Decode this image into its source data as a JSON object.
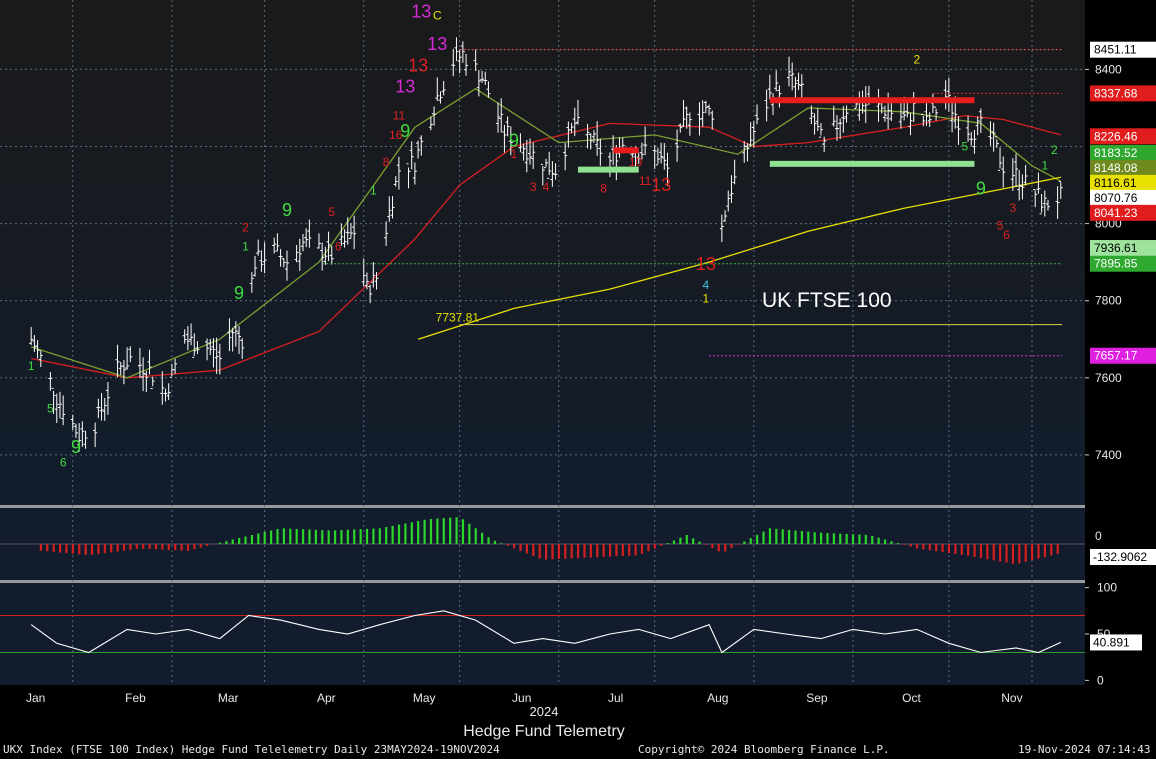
{
  "chart_data": [
    {
      "type": "ohlc",
      "title": "UK FTSE 100",
      "subtitle": "Hedge Fund Telemetry",
      "xlabel": "2024",
      "months": [
        "Jan",
        "Feb",
        "Mar",
        "Apr",
        "May",
        "Jun",
        "Jul",
        "Aug",
        "Sep",
        "Oct",
        "Nov"
      ],
      "ylim": [
        7270,
        8580
      ],
      "yticks": [
        7400,
        7600,
        7800,
        8000,
        8400
      ],
      "ytick_labels": [
        "7400",
        "7600",
        "7800",
        "8000",
        "8400"
      ],
      "grid": true,
      "close_path": [
        [
          "2024-01-02",
          7700
        ],
        [
          "2024-01-05",
          7650
        ],
        [
          "2024-01-10",
          7550
        ],
        [
          "2024-01-17",
          7450
        ],
        [
          "2024-01-22",
          7480
        ],
        [
          "2024-01-29",
          7620
        ],
        [
          "2024-02-02",
          7650
        ],
        [
          "2024-02-08",
          7620
        ],
        [
          "2024-02-13",
          7560
        ],
        [
          "2024-02-19",
          7700
        ],
        [
          "2024-02-26",
          7680
        ],
        [
          "2024-03-01",
          7650
        ],
        [
          "2024-03-05",
          7720
        ],
        [
          "2024-03-08",
          7700
        ],
        [
          "2024-03-12",
          7900
        ],
        [
          "2024-03-18",
          7930
        ],
        [
          "2024-03-22",
          7900
        ],
        [
          "2024-03-27",
          7950
        ],
        [
          "2024-04-02",
          7930
        ],
        [
          "2024-04-05",
          7920
        ],
        [
          "2024-04-09",
          7950
        ],
        [
          "2024-04-12",
          7980
        ],
        [
          "2024-04-16",
          7830
        ],
        [
          "2024-04-19",
          7860
        ],
        [
          "2024-04-23",
          8030
        ],
        [
          "2024-04-26",
          8140
        ],
        [
          "2024-05-01",
          8160
        ],
        [
          "2024-05-08",
          8330
        ],
        [
          "2024-05-13",
          8420
        ],
        [
          "2024-05-16",
          8440
        ],
        [
          "2024-05-22",
          8380
        ],
        [
          "2024-05-29",
          8240
        ],
        [
          "2024-06-04",
          8200
        ],
        [
          "2024-06-11",
          8150
        ],
        [
          "2024-06-14",
          8140
        ],
        [
          "2024-06-20",
          8260
        ],
        [
          "2024-06-25",
          8220
        ],
        [
          "2024-07-01",
          8160
        ],
        [
          "2024-07-05",
          8210
        ],
        [
          "2024-07-10",
          8190
        ],
        [
          "2024-07-16",
          8180
        ],
        [
          "2024-07-19",
          8140
        ],
        [
          "2024-07-26",
          8290
        ],
        [
          "2024-08-02",
          8290
        ],
        [
          "2024-08-05",
          7990
        ],
        [
          "2024-08-07",
          8070
        ],
        [
          "2024-08-14",
          8220
        ],
        [
          "2024-08-20",
          8330
        ],
        [
          "2024-08-26",
          8380
        ],
        [
          "2024-08-30",
          8340
        ],
        [
          "2024-09-06",
          8200
        ],
        [
          "2024-09-13",
          8300
        ],
        [
          "2024-09-20",
          8310
        ],
        [
          "2024-09-27",
          8290
        ],
        [
          "2024-10-02",
          8270
        ],
        [
          "2024-10-04",
          8300
        ],
        [
          "2024-10-08",
          8260
        ],
        [
          "2024-10-14",
          8330
        ],
        [
          "2024-10-18",
          8270
        ],
        [
          "2024-10-22",
          8240
        ],
        [
          "2024-10-25",
          8250
        ],
        [
          "2024-10-29",
          8210
        ],
        [
          "2024-11-01",
          8150
        ],
        [
          "2024-11-06",
          8120
        ],
        [
          "2024-11-11",
          8080
        ],
        [
          "2024-11-14",
          8050
        ],
        [
          "2024-11-19",
          8070
        ]
      ],
      "ma_red": [
        [
          "2024-01-02",
          7650
        ],
        [
          "2024-02-01",
          7600
        ],
        [
          "2024-03-01",
          7620
        ],
        [
          "2024-04-01",
          7720
        ],
        [
          "2024-05-01",
          7960
        ],
        [
          "2024-05-15",
          8100
        ],
        [
          "2024-06-01",
          8200
        ],
        [
          "2024-07-01",
          8260
        ],
        [
          "2024-08-01",
          8250
        ],
        [
          "2024-08-15",
          8200
        ],
        [
          "2024-09-01",
          8210
        ],
        [
          "2024-10-01",
          8250
        ],
        [
          "2024-10-20",
          8280
        ],
        [
          "2024-11-01",
          8270
        ],
        [
          "2024-11-19",
          8230
        ]
      ],
      "ma_green": [
        [
          "2024-01-02",
          7680
        ],
        [
          "2024-02-01",
          7600
        ],
        [
          "2024-03-01",
          7700
        ],
        [
          "2024-04-01",
          7900
        ],
        [
          "2024-05-01",
          8250
        ],
        [
          "2024-05-20",
          8350
        ],
        [
          "2024-06-15",
          8210
        ],
        [
          "2024-07-15",
          8230
        ],
        [
          "2024-08-10",
          8180
        ],
        [
          "2024-09-01",
          8300
        ],
        [
          "2024-10-01",
          8290
        ],
        [
          "2024-10-25",
          8260
        ],
        [
          "2024-11-10",
          8150
        ],
        [
          "2024-11-19",
          8110
        ]
      ],
      "ma_yellow": [
        [
          "2024-05-02",
          7700
        ],
        [
          "2024-06-01",
          7780
        ],
        [
          "2024-07-01",
          7830
        ],
        [
          "2024-08-01",
          7900
        ],
        [
          "2024-09-01",
          7980
        ],
        [
          "2024-10-01",
          8040
        ],
        [
          "2024-11-01",
          8090
        ],
        [
          "2024-11-19",
          8120
        ]
      ],
      "hlines": [
        {
          "value": 8451.11,
          "color": "#ff5a5a",
          "dashed": true,
          "from": "2024-05-15"
        },
        {
          "value": 8337.68,
          "color": "#e03030",
          "dashed": true,
          "from": "2024-10-10"
        },
        {
          "value": 7895.85,
          "color": "#3fbf3f",
          "dashed": true,
          "from": "2024-04-02"
        },
        {
          "value": 7737.81,
          "color": "#d8d040",
          "dashed": false,
          "from": "2024-05-15"
        },
        {
          "value": 7657.17,
          "color": "#cc33cc",
          "dashed": true,
          "from": "2024-08-01"
        }
      ],
      "range_text": "7737.81",
      "bars_red": [
        {
          "value": 8320,
          "from": "2024-08-20",
          "to": "2024-10-23"
        },
        {
          "value": 8190,
          "from": "2024-07-02",
          "to": "2024-07-10"
        }
      ],
      "bars_green": [
        {
          "value": 8155,
          "from": "2024-08-20",
          "to": "2024-10-23"
        },
        {
          "value": 8140,
          "from": "2024-06-21",
          "to": "2024-07-10"
        }
      ],
      "right_labels": [
        {
          "value": 8451.11,
          "text": "8451.11",
          "bg": "#ffffff",
          "fg": "#000000"
        },
        {
          "value": 8337.68,
          "text": "8337.68",
          "bg": "#e01c1c",
          "fg": "#ffffff"
        },
        {
          "value": 8226.46,
          "text": "8226.46",
          "bg": "#e01c1c",
          "fg": "#ffffff"
        },
        {
          "value": 8183.52,
          "text": "8183.52",
          "bg": "#2ea82e",
          "fg": "#ffffff"
        },
        {
          "value": 8148.08,
          "text": "8148.08",
          "bg": "#6e8a1e",
          "fg": "#ffffff"
        },
        {
          "value": 8116.61,
          "text": "8116.61",
          "bg": "#e8e000",
          "fg": "#000000"
        },
        {
          "value": 8070.76,
          "text": "8070.76",
          "bg": "#ffffff",
          "fg": "#000000"
        },
        {
          "value": 8041.23,
          "text": "8041.23",
          "bg": "#e01c1c",
          "fg": "#ffffff"
        },
        {
          "value": 7936.61,
          "text": "7936.61",
          "bg": "#9ee39e",
          "fg": "#000000"
        },
        {
          "value": 7895.85,
          "text": "7895.85",
          "bg": "#2ea82e",
          "fg": "#ffffff"
        },
        {
          "value": 7657.17,
          "text": "7657.17",
          "bg": "#e020e0",
          "fg": "#ffffff"
        }
      ],
      "annotations": [
        {
          "text": "13",
          "date": "2024-05-03",
          "value": 8535,
          "color": "#d62bd6"
        },
        {
          "text": "C",
          "date": "2024-05-08",
          "value": 8530,
          "color": "#e8e000"
        },
        {
          "text": "13",
          "date": "2024-05-08",
          "value": 8450,
          "color": "#d62bd6"
        },
        {
          "text": "13",
          "date": "2024-05-02",
          "value": 8395,
          "color": "#e02020"
        },
        {
          "text": "13",
          "date": "2024-04-28",
          "value": 8340,
          "color": "#d62bd6"
        },
        {
          "text": "9",
          "date": "2024-04-28",
          "value": 8225,
          "color": "#3fdc3f"
        },
        {
          "text": "9",
          "date": "2024-03-22",
          "value": 8020,
          "color": "#3fdc3f"
        },
        {
          "text": "9",
          "date": "2024-03-07",
          "value": 7805,
          "color": "#3fdc3f"
        },
        {
          "text": "9",
          "date": "2024-01-16",
          "value": 7405,
          "color": "#3fdc3f"
        },
        {
          "text": "9",
          "date": "2024-06-01",
          "value": 8200,
          "color": "#3fdc3f"
        },
        {
          "text": "9",
          "date": "2024-10-25",
          "value": 8075,
          "color": "#3fdc3f"
        },
        {
          "text": "13",
          "date": "2024-07-31",
          "value": 7880,
          "color": "#e02020"
        },
        {
          "text": "4",
          "date": "2024-07-31",
          "value": 7830,
          "color": "#40c0e0"
        },
        {
          "text": "1",
          "date": "2024-07-31",
          "value": 7795,
          "color": "#e8e000"
        },
        {
          "text": "2",
          "date": "2024-10-05",
          "value": 8415,
          "color": "#e8e000"
        },
        {
          "text": "1",
          "date": "2024-04-18",
          "value": 8075,
          "color": "#3fdc3f"
        },
        {
          "text": "8",
          "date": "2024-04-22",
          "value": 8150,
          "color": "#e02020"
        },
        {
          "text": "11",
          "date": "2024-04-26",
          "value": 8270,
          "color": "#e02020"
        },
        {
          "text": "16",
          "date": "2024-04-25",
          "value": 8220,
          "color": "#e02020"
        },
        {
          "text": "1",
          "date": "2024-01-02",
          "value": 7620,
          "color": "#3fdc3f"
        },
        {
          "text": "5",
          "date": "2024-01-08",
          "value": 7510,
          "color": "#3fdc3f"
        },
        {
          "text": "6",
          "date": "2024-01-12",
          "value": 7370,
          "color": "#3fdc3f"
        },
        {
          "text": "2",
          "date": "2024-03-09",
          "value": 7980,
          "color": "#e02020"
        },
        {
          "text": "1",
          "date": "2024-03-09",
          "value": 7930,
          "color": "#3fdc3f"
        },
        {
          "text": "5",
          "date": "2024-04-05",
          "value": 8020,
          "color": "#e02020"
        },
        {
          "text": "6",
          "date": "2024-04-07",
          "value": 7930,
          "color": "#e02020"
        },
        {
          "text": "1",
          "date": "2024-06-01",
          "value": 8170,
          "color": "#e02020"
        },
        {
          "text": "3",
          "date": "2024-06-07",
          "value": 8085,
          "color": "#e02020"
        },
        {
          "text": "4",
          "date": "2024-06-11",
          "value": 8085,
          "color": "#e02020"
        },
        {
          "text": "8",
          "date": "2024-06-29",
          "value": 8080,
          "color": "#e02020"
        },
        {
          "text": "10",
          "date": "2024-07-09",
          "value": 8150,
          "color": "#e02020"
        },
        {
          "text": "11",
          "date": "2024-07-12",
          "value": 8100,
          "color": "#e02020"
        },
        {
          "text": "13",
          "date": "2024-07-17",
          "value": 8085,
          "color": "#e02020"
        },
        {
          "text": "5",
          "date": "2024-10-20",
          "value": 8190,
          "color": "#3fdc3f"
        },
        {
          "text": "1",
          "date": "2024-11-14",
          "value": 8140,
          "color": "#3fdc3f"
        },
        {
          "text": "2",
          "date": "2024-11-17",
          "value": 8180,
          "color": "#3fdc3f"
        },
        {
          "text": "3",
          "date": "2024-11-04",
          "value": 8030,
          "color": "#e02020"
        },
        {
          "text": "5",
          "date": "2024-10-31",
          "value": 7985,
          "color": "#e02020"
        },
        {
          "text": "6",
          "date": "2024-11-02",
          "value": 7960,
          "color": "#e02020"
        }
      ],
      "color_red": "#d82020",
      "color_green": "#7aa030",
      "color_yellow": "#e8e000",
      "background": "#121c2c"
    },
    {
      "type": "bar",
      "title": "",
      "ylim": [
        -80,
        80
      ],
      "ytick_labels": [
        "0"
      ],
      "value_label": "-132.9062",
      "series": [
        {
          "name": "",
          "color_pos": "#2cd42c",
          "color_neg": "#d42020",
          "x": [
            "2024-01-05",
            "2024-01-20",
            "2024-02-05",
            "2024-02-20",
            "2024-03-05",
            "2024-03-20",
            "2024-04-05",
            "2024-04-20",
            "2024-05-05",
            "2024-05-15",
            "2024-05-25",
            "2024-06-10",
            "2024-06-25",
            "2024-07-10",
            "2024-07-25",
            "2024-08-05",
            "2024-08-20",
            "2024-09-05",
            "2024-09-20",
            "2024-10-05",
            "2024-10-20",
            "2024-11-05",
            "2024-11-19"
          ],
          "values": [
            -15,
            -25,
            -10,
            -15,
            10,
            35,
            30,
            35,
            55,
            60,
            10,
            -35,
            -30,
            -25,
            20,
            -20,
            35,
            25,
            20,
            -10,
            -25,
            -45,
            -20
          ]
        }
      ]
    },
    {
      "type": "line",
      "title": "",
      "ylim": [
        -5,
        105
      ],
      "yticks": [
        0,
        50,
        100
      ],
      "ytick_labels": [
        "0",
        "50",
        "100"
      ],
      "hlines": [
        70,
        30
      ],
      "value_label": "40.891",
      "series": [
        {
          "name": "",
          "color": "#ffffff",
          "x": [
            "2024-01-02",
            "2024-01-10",
            "2024-01-20",
            "2024-02-01",
            "2024-02-10",
            "2024-02-20",
            "2024-03-01",
            "2024-03-10",
            "2024-03-20",
            "2024-04-01",
            "2024-04-10",
            "2024-04-20",
            "2024-05-01",
            "2024-05-10",
            "2024-05-20",
            "2024-06-01",
            "2024-06-10",
            "2024-06-20",
            "2024-07-01",
            "2024-07-10",
            "2024-07-20",
            "2024-08-01",
            "2024-08-05",
            "2024-08-15",
            "2024-08-25",
            "2024-09-05",
            "2024-09-15",
            "2024-09-25",
            "2024-10-05",
            "2024-10-15",
            "2024-10-25",
            "2024-11-05",
            "2024-11-12",
            "2024-11-19"
          ],
          "values": [
            60,
            40,
            30,
            55,
            50,
            55,
            45,
            70,
            65,
            55,
            50,
            60,
            70,
            75,
            65,
            40,
            45,
            40,
            50,
            55,
            45,
            60,
            30,
            55,
            50,
            45,
            55,
            50,
            55,
            40,
            30,
            35,
            30,
            40.891
          ]
        }
      ]
    }
  ],
  "footer": {
    "left": "UKX Index (FTSE 100 Index) Hedge Fund Telelemetry  Daily 23MAY2024-19NOV2024",
    "center": "Copyright© 2024 Bloomberg Finance L.P.",
    "right": "19-Nov-2024 07:14:43"
  }
}
